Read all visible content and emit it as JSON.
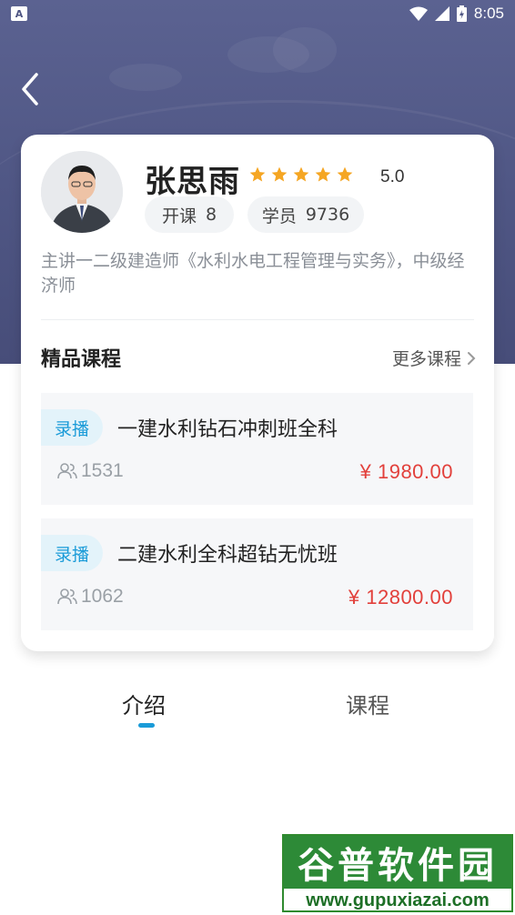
{
  "status_bar": {
    "time": "8:05",
    "left_icon": "A"
  },
  "teacher": {
    "name": "张思雨",
    "rating": "5.0",
    "stars_filled": 5,
    "courses_label": "开课",
    "courses_count": "8",
    "students_label": "学员",
    "students_count": "9736",
    "bio": "主讲一二级建造师《水利水电工程管理与实务》，中级经济师"
  },
  "featured": {
    "title": "精品课程",
    "more_label": "更多课程",
    "courses": [
      {
        "tag": "录播",
        "title": "一建水利钻石冲刺班全科",
        "students": "1531",
        "price": "¥ 1980.00"
      },
      {
        "tag": "录播",
        "title": "二建水利全科超钻无忧班",
        "students": "1062",
        "price": "¥ 12800.00"
      }
    ]
  },
  "tabs": [
    {
      "label": "介绍",
      "active": true
    },
    {
      "label": "课程",
      "active": false
    }
  ],
  "watermark": {
    "title": "谷普软件园",
    "url": "www.gupuxiazai.com"
  },
  "colors": {
    "hero": "#4f5684",
    "accent_blue": "#1a9bd8",
    "price_red": "#e2403b",
    "star": "#f5a623"
  },
  "icons": {
    "back": "chevron-left-icon",
    "star": "star-icon",
    "more": "chevron-right-icon",
    "students": "users-icon"
  }
}
